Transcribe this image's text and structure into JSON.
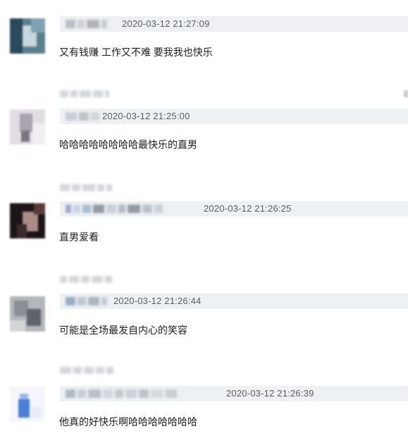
{
  "comments": [
    {
      "timestamp": "2020-03-12 21:27:09",
      "text": "又有钱赚 工作又不难 要我我也快乐",
      "avatar_colors": [
        "#2a4a5c",
        "#7fa3b2",
        "#c7d7dc",
        "#5c7f8c"
      ]
    },
    {
      "timestamp": "2020-03-12 21:25:00",
      "text": "哈哈哈哈哈哈哈哈最快乐的直男",
      "avatar_colors": [
        "#e2dde2",
        "#a9a4ad",
        "#f1eef1",
        "#7a7680"
      ]
    },
    {
      "timestamp": "2020-03-12 21:26:25",
      "text": "直男爱看",
      "avatar_colors": [
        "#1c1416",
        "#3a2a2c",
        "#a98c86",
        "#5a3b3a"
      ]
    },
    {
      "timestamp": "2020-03-12 21:26:44",
      "text": "可能是全场最发自内心的笑容",
      "avatar_colors": [
        "#8c9096",
        "#b3b6bb",
        "#5f646b",
        "#d3d5d8"
      ]
    },
    {
      "timestamp": "2020-03-12 21:26:39",
      "text": "他真的好快乐啊哈哈哈哈哈哈哈",
      "avatar_colors": [
        "#f4f6fb",
        "#4a7fd8",
        "#9bb8ec",
        "#e8ecf6"
      ]
    }
  ]
}
